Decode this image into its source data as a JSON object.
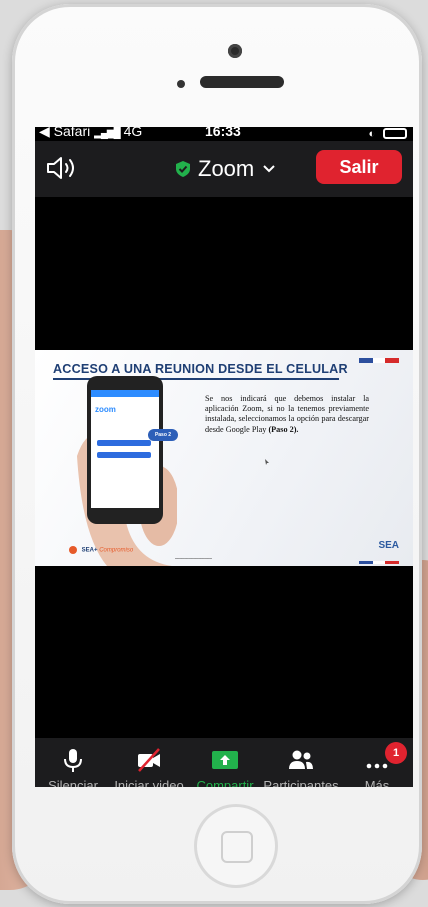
{
  "status_bar": {
    "carrier": "◀ Safari",
    "network": "4G",
    "time": "16:33"
  },
  "header": {
    "meeting_title": "Zoom",
    "leave_label": "Salir",
    "shield_color": "#22b14c",
    "leave_color": "#e0232f"
  },
  "slide": {
    "title": "ACCESO A UNA REUNION DESDE EL CELULAR",
    "body_prefix": "Se nos indicará que debemos instalar la aplicación Zoom, si no la tenemos previamente instalada, seleccionamos la opción para descargar desde Google Play ",
    "body_bold": "(Paso 2).",
    "phone_app_name": "zoom",
    "bubble_label": "Paso 2",
    "logo_left_main": "SEA+",
    "logo_left_script": "Compromiso",
    "logo_right": "SEA",
    "title_color": "#1f3f74"
  },
  "toolbar": {
    "items": [
      {
        "label": "Silenciar",
        "icon": "microphone-icon"
      },
      {
        "label": "Iniciar video",
        "icon": "video-off-icon"
      },
      {
        "label": "Compartir",
        "icon": "share-screen-icon"
      },
      {
        "label": "Participantes",
        "icon": "participants-icon"
      },
      {
        "label": "Más",
        "icon": "more-icon"
      }
    ],
    "more_badge": "1",
    "share_color": "#22b14c"
  }
}
